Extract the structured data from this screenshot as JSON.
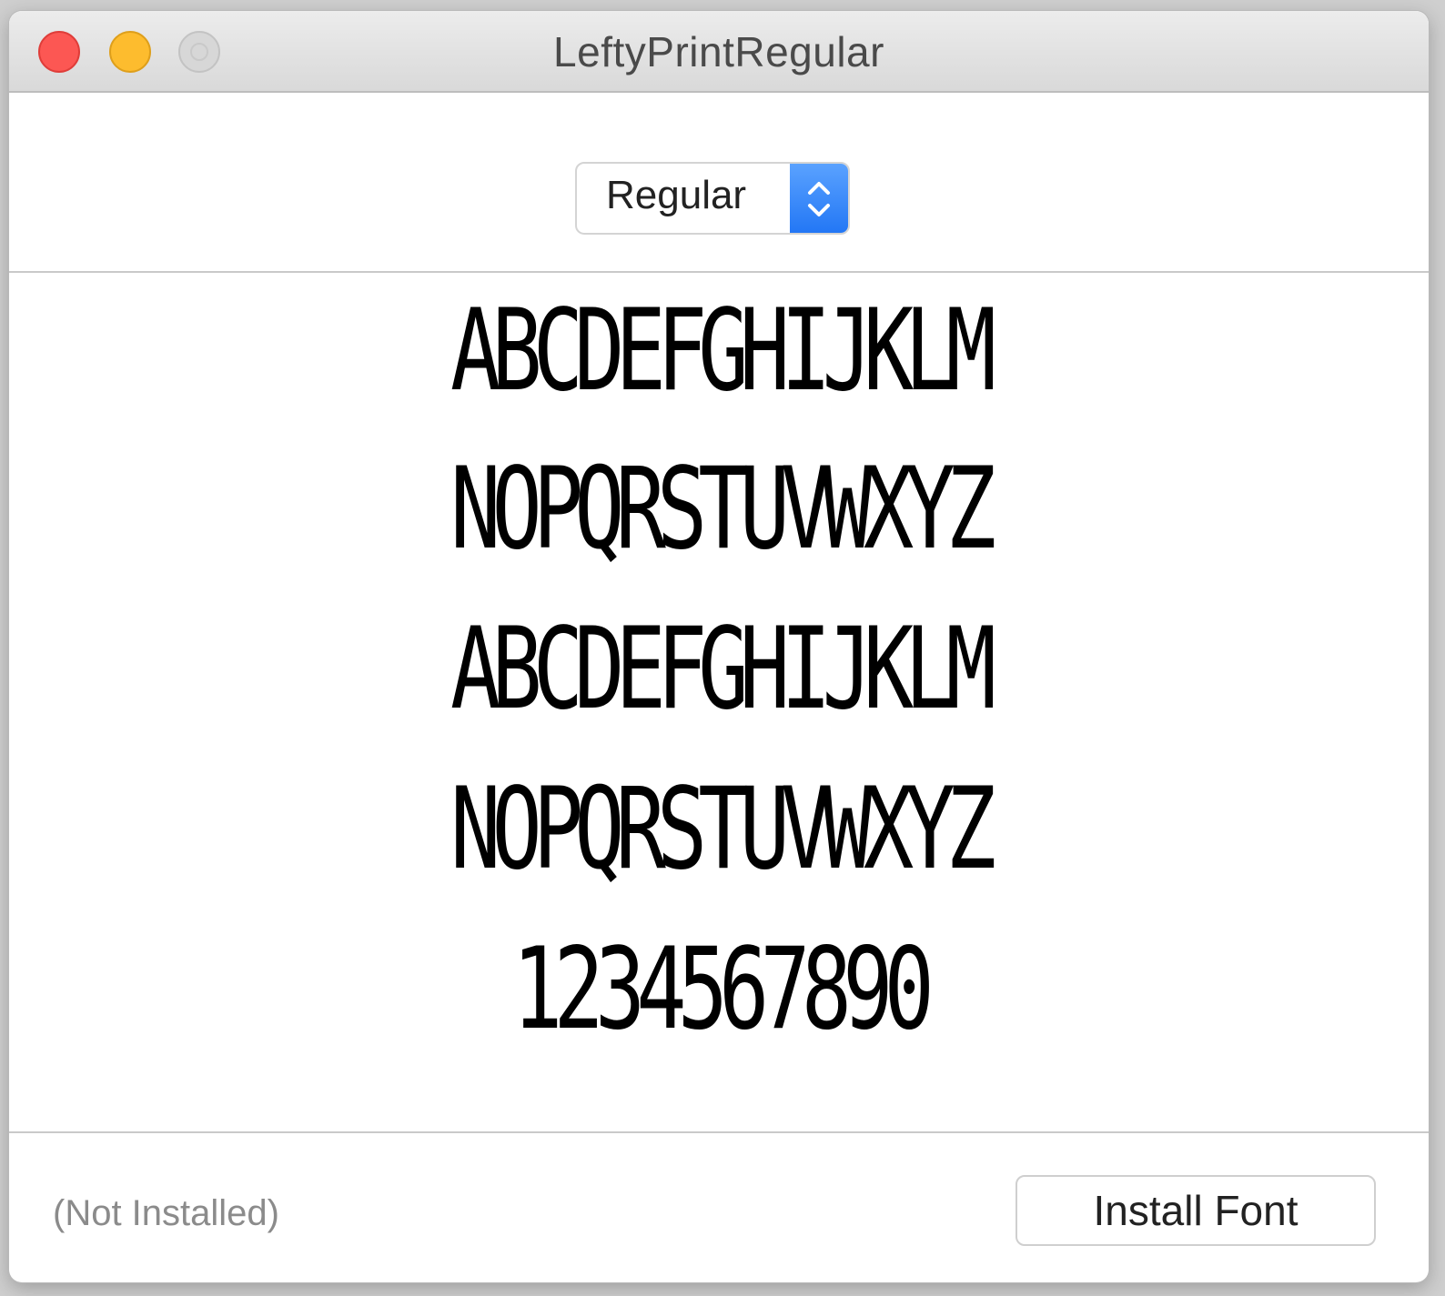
{
  "window": {
    "title": "LeftyPrintRegular"
  },
  "style_popup": {
    "selected": "Regular"
  },
  "preview": {
    "lines": [
      "ABCDEFGHIJKLM",
      "NOPQRSTUVWXYZ",
      "ABCDEFGHIJKLM",
      "NOPQRSTUVWXYZ",
      "1234567890"
    ]
  },
  "footer": {
    "status": "(Not Installed)",
    "install_label": "Install Font"
  },
  "colors": {
    "close": "#fc5753",
    "minimize": "#fdbc2e",
    "zoom_disabled": "#d7d7d7",
    "accent": "#2377f5"
  },
  "icons": [
    "close-icon",
    "minimize-icon",
    "zoom-icon",
    "chevron-updown-icon"
  ]
}
